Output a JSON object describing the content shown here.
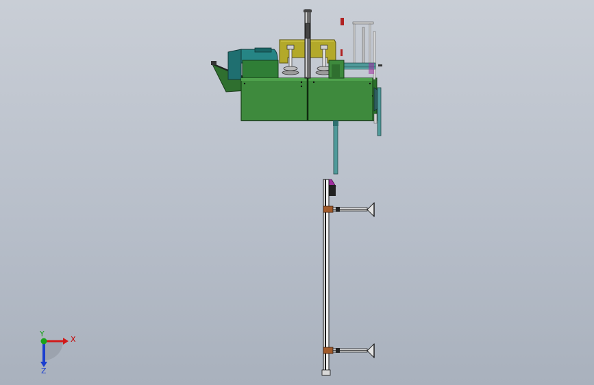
{
  "viewport": {
    "background_top": "#c9ced6",
    "background_bottom": "#a9b1bd"
  },
  "model": {
    "colors": {
      "frame_green": "#3f8a3f",
      "frame_green_dark": "#2b6a2b",
      "motor_teal": "#1f7a7a",
      "guard_olive": "#b3a92a",
      "rail_black": "#1a1a1a",
      "bracket_brown": "#a15a2a",
      "pipe_teal": "#4f9a9a",
      "accent_magenta": "#a030a0",
      "accent_red": "#b02020"
    }
  },
  "triad": {
    "x_label": "X",
    "y_label": "Y",
    "z_label": "Z",
    "x_color": "#d11a1a",
    "y_color": "#1aa31a",
    "z_color": "#1b3fcf"
  }
}
